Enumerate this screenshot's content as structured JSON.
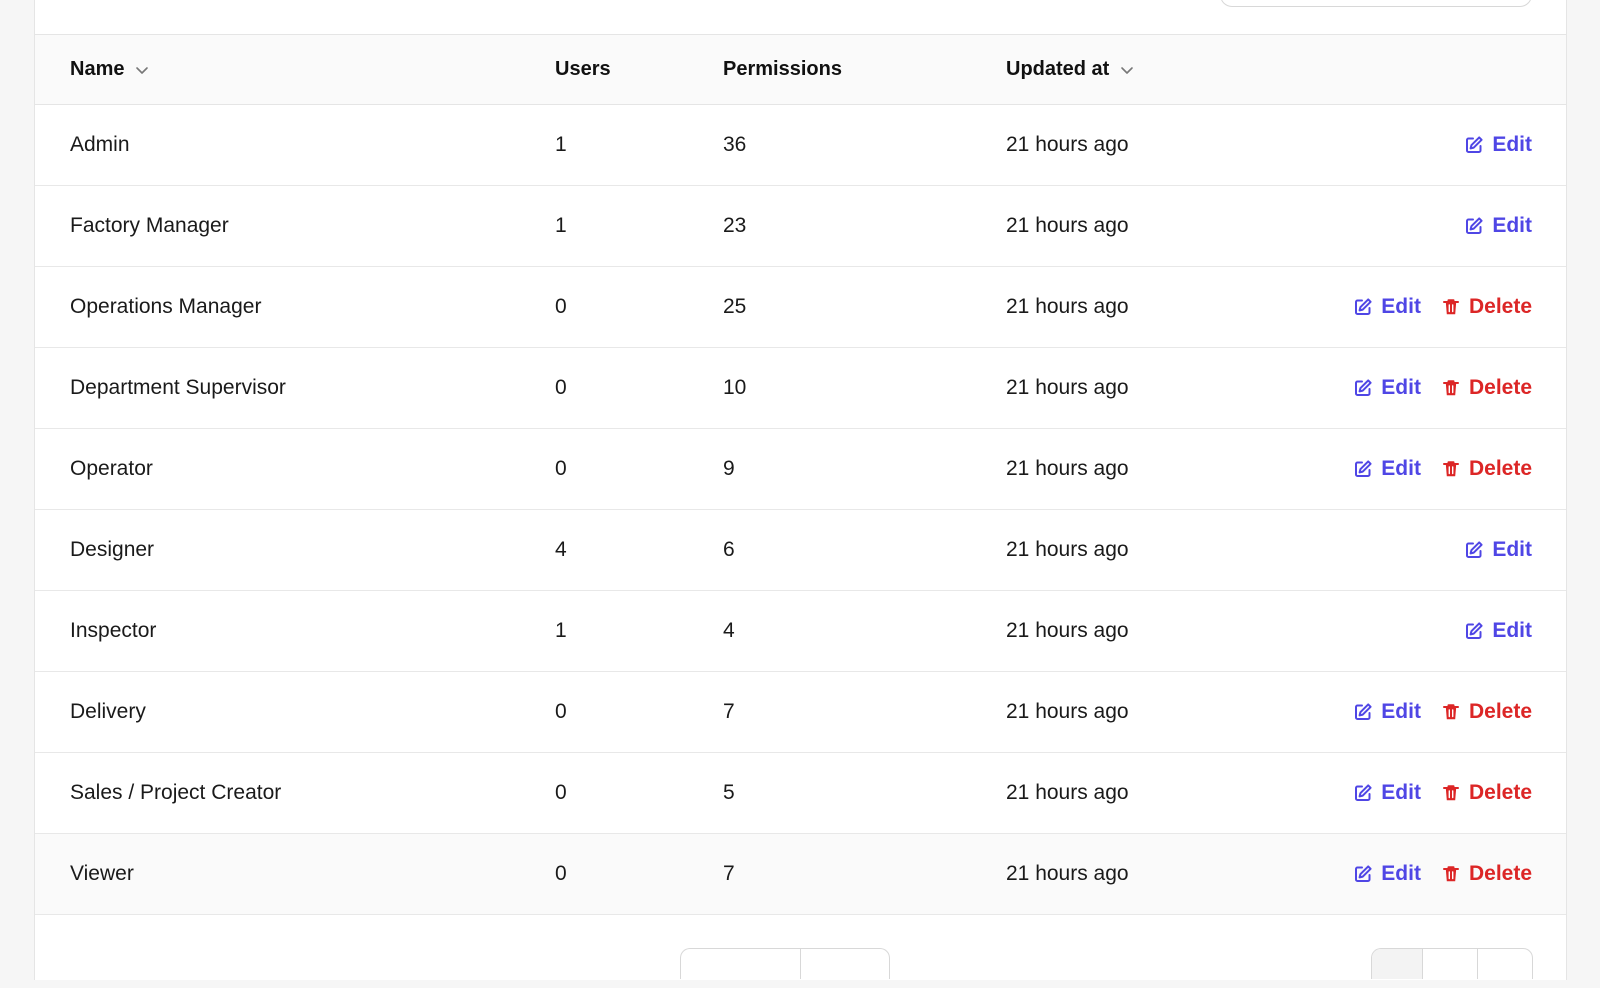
{
  "table": {
    "headers": {
      "name": "Name",
      "users": "Users",
      "permissions": "Permissions",
      "updated_at": "Updated at"
    },
    "actions": {
      "edit_label": "Edit",
      "delete_label": "Delete"
    },
    "rows": [
      {
        "name": "Admin",
        "users": "1",
        "permissions": "36",
        "updated": "21 hours ago",
        "deletable": false
      },
      {
        "name": "Factory Manager",
        "users": "1",
        "permissions": "23",
        "updated": "21 hours ago",
        "deletable": false
      },
      {
        "name": "Operations Manager",
        "users": "0",
        "permissions": "25",
        "updated": "21 hours ago",
        "deletable": true
      },
      {
        "name": "Department Supervisor",
        "users": "0",
        "permissions": "10",
        "updated": "21 hours ago",
        "deletable": true
      },
      {
        "name": "Operator",
        "users": "0",
        "permissions": "9",
        "updated": "21 hours ago",
        "deletable": true
      },
      {
        "name": "Designer",
        "users": "4",
        "permissions": "6",
        "updated": "21 hours ago",
        "deletable": false
      },
      {
        "name": "Inspector",
        "users": "1",
        "permissions": "4",
        "updated": "21 hours ago",
        "deletable": false
      },
      {
        "name": "Delivery",
        "users": "0",
        "permissions": "7",
        "updated": "21 hours ago",
        "deletable": true
      },
      {
        "name": "Sales / Project Creator",
        "users": "0",
        "permissions": "5",
        "updated": "21 hours ago",
        "deletable": true
      },
      {
        "name": "Viewer",
        "users": "0",
        "permissions": "7",
        "updated": "21 hours ago",
        "deletable": true
      }
    ]
  },
  "colors": {
    "edit": "#4f46e5",
    "delete": "#dc2626"
  },
  "icons": {
    "edit": "pencil-square-icon",
    "delete": "trash-icon",
    "sort": "chevron-down-icon"
  }
}
